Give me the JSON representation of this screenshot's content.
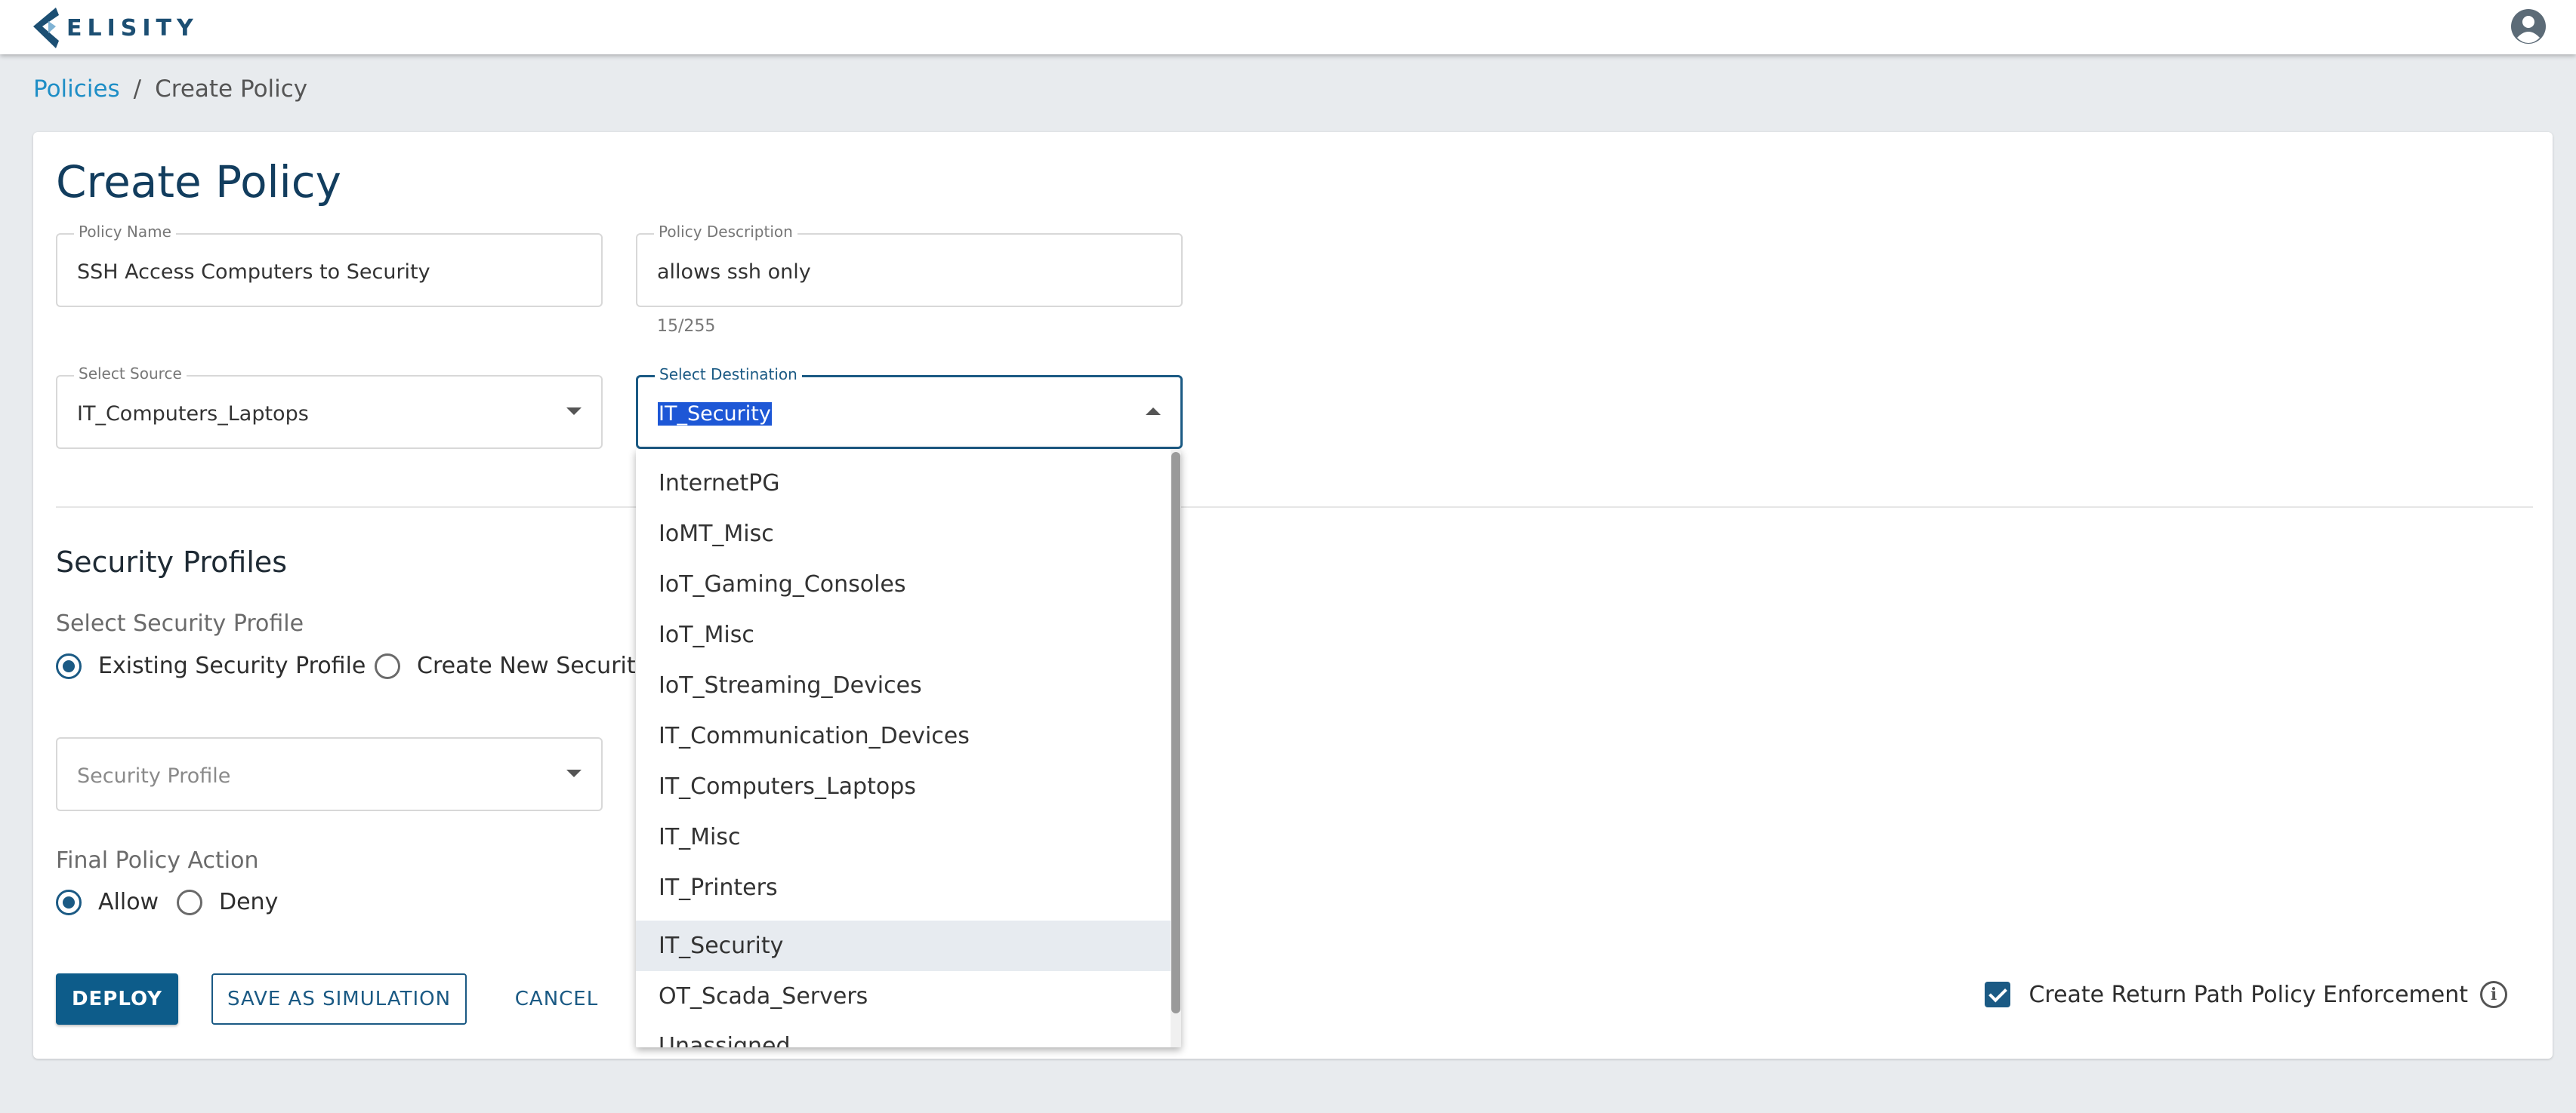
{
  "app": {
    "brand": "ELISITY"
  },
  "breadcrumb": {
    "parent": "Policies",
    "separator": "/",
    "current": "Create Policy"
  },
  "page": {
    "title": "Create Policy"
  },
  "form": {
    "policy_name": {
      "label": "Policy Name",
      "value": "SSH Access Computers to Security"
    },
    "policy_description": {
      "label": "Policy Description",
      "value": "allows ssh only",
      "counter": "15/255"
    },
    "source": {
      "label": "Select Source",
      "value": "IT_Computers_Laptops"
    },
    "destination": {
      "label": "Select Destination",
      "value": "IT_Security"
    }
  },
  "security_profiles": {
    "title": "Security Profiles",
    "select_label": "Select Security Profile",
    "options": [
      "Existing Security Profile",
      "Create New Security"
    ],
    "selected": "Existing Security Profile",
    "profile_field": {
      "placeholder": "Security Profile"
    }
  },
  "final_action": {
    "label": "Final Policy Action",
    "options": [
      "Allow",
      "Deny"
    ],
    "selected": "Allow"
  },
  "buttons": {
    "deploy": "DEPLOY",
    "simulate": "SAVE AS SIMULATION",
    "cancel": "CANCEL"
  },
  "return_path": {
    "label": "Create Return Path Policy Enforcement",
    "checked": true
  },
  "destination_dropdown": {
    "items": [
      "InternetPG",
      "IoMT_Misc",
      "IoT_Gaming_Consoles",
      "IoT_Misc",
      "IoT_Streaming_Devices",
      "IT_Communication_Devices",
      "IT_Computers_Laptops",
      "IT_Misc",
      "IT_Printers",
      "IT_Security",
      "OT_Scada_Servers",
      "Unassigned"
    ],
    "highlighted": "IT_Security"
  },
  "colors": {
    "primary": "#0d5c8a",
    "link": "#1e8ec6",
    "title": "#123d5e",
    "background": "#e8ebee"
  },
  "icons": {
    "avatar": "account-circle-icon",
    "info": "info-icon",
    "caret": "arrow-drop-down-icon"
  }
}
